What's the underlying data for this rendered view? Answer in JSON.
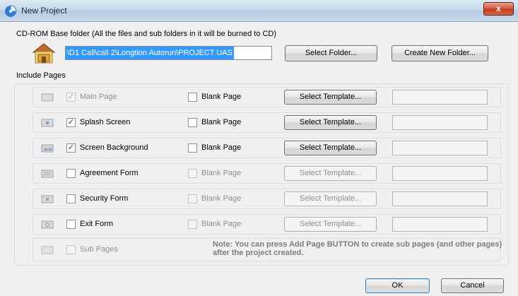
{
  "window": {
    "title": "New Project",
    "close_label": "x"
  },
  "folder": {
    "label": "CD-ROM Base folder (All the files and sub folders in it will be burned to CD)",
    "path": "\\D1 Call\\call 2\\Longtion Autorun\\PROJECT UAS",
    "select_button": "Select Folder...",
    "create_button": "Create New Folder..."
  },
  "include_pages": {
    "label": "Include Pages",
    "blank_label": "Blank Page",
    "template_button": "Select Template...",
    "rows": [
      {
        "name": "Main Page",
        "checked": true,
        "enabled": false
      },
      {
        "name": "Splash Screen",
        "checked": true,
        "enabled": true
      },
      {
        "name": "Screen Background",
        "checked": true,
        "enabled": true
      },
      {
        "name": "Agreement Form",
        "checked": false,
        "enabled": true
      },
      {
        "name": "Security Form",
        "checked": false,
        "enabled": true
      },
      {
        "name": "Exit Form",
        "checked": false,
        "enabled": true
      }
    ],
    "sub_pages": {
      "name": "Sub Pages",
      "note": "Note: You can press Add Page BUTTON to create sub pages (and other pages) after the project created."
    }
  },
  "footer": {
    "ok_label": "OK",
    "cancel_label": "Cancel"
  }
}
